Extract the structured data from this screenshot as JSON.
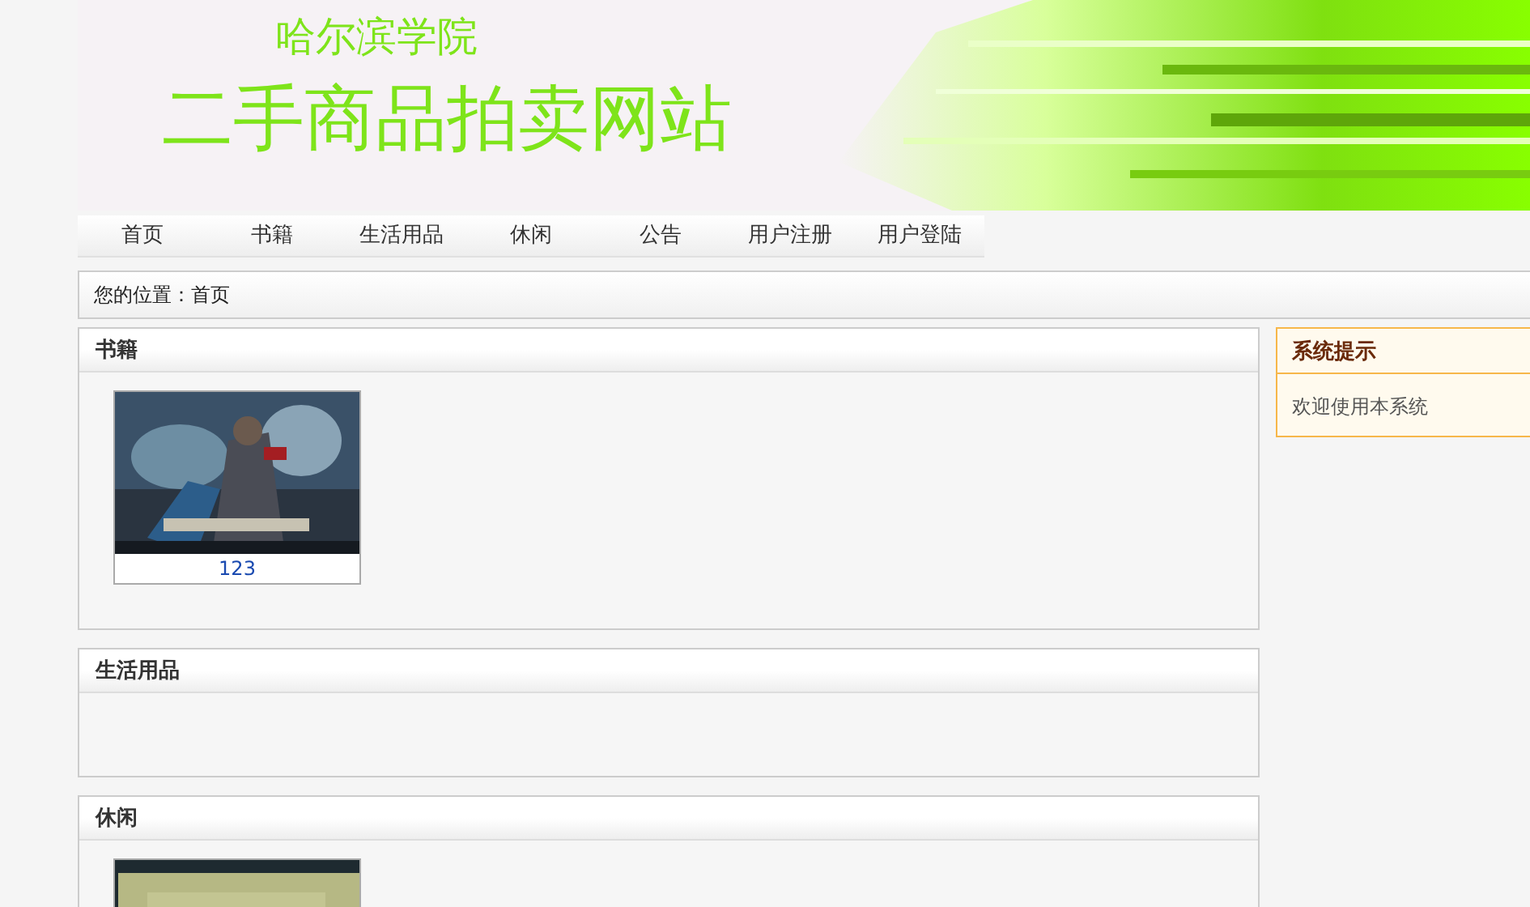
{
  "header": {
    "school": "哈尔滨学院",
    "title": "二手商品拍卖网站"
  },
  "nav": [
    {
      "label": "首页"
    },
    {
      "label": "书籍"
    },
    {
      "label": "生活用品"
    },
    {
      "label": "休闲"
    },
    {
      "label": "公告"
    },
    {
      "label": "用户注册"
    },
    {
      "label": "用户登陆"
    }
  ],
  "breadcrumb": "您的位置：首页",
  "sections": [
    {
      "title": "书籍",
      "items": [
        {
          "kind": "picture",
          "caption": "123"
        }
      ]
    },
    {
      "title": "生活用品"
    },
    {
      "title": "休闲"
    }
  ],
  "notice": {
    "title": "系统提示",
    "text": "欢迎使用本系统"
  }
}
